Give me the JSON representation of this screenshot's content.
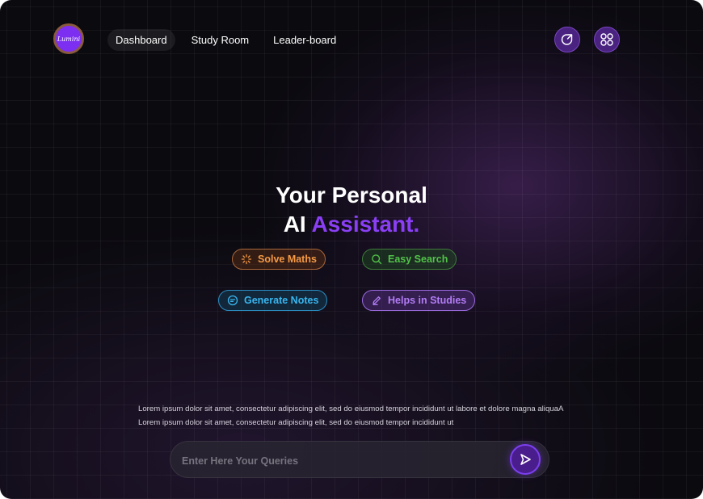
{
  "brand": {
    "logo_text": "Lumini"
  },
  "nav": {
    "items": [
      {
        "label": "Dashboard",
        "active": true
      },
      {
        "label": "Study Room",
        "active": false
      },
      {
        "label": "Leader-board",
        "active": false
      }
    ]
  },
  "header_actions": [
    {
      "icon": "refresh-arrow-icon"
    },
    {
      "icon": "grid-apps-icon"
    }
  ],
  "hero": {
    "line1": "Your Personal",
    "line2_prefix": "AI",
    "line2_accent": "Assistant."
  },
  "features": [
    {
      "label": "Solve Maths",
      "icon": "spinner-icon",
      "color": "#f59a45"
    },
    {
      "label": "Easy Search",
      "icon": "search-icon",
      "color": "#52c24a"
    },
    {
      "label": "Generate Notes",
      "icon": "notes-icon",
      "color": "#38b6ef"
    },
    {
      "label": "Helps in Studies",
      "icon": "pencil-icon",
      "color": "#b27df5"
    }
  ],
  "description": {
    "line1": "Lorem ipsum dolor sit amet, consectetur adipiscing elit, sed do eiusmod tempor incididunt ut labore et dolore magna aliquaA",
    "line2": "Lorem ipsum dolor sit amet, consectetur adipiscing elit, sed do eiusmod tempor incididunt ut"
  },
  "query": {
    "placeholder": "Enter Here Your Queries",
    "value": ""
  },
  "colors": {
    "accent": "#8a3ff5",
    "background": "#0b0a0f"
  }
}
